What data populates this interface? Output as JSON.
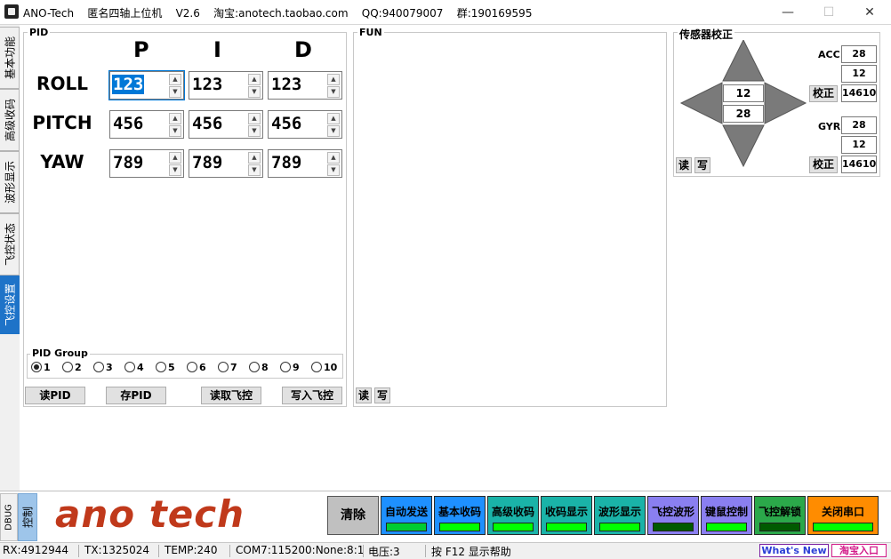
{
  "window": {
    "title": "ANO-Tech    匿名四轴上位机    V2.6    淘宝:anotech.taobao.com    QQ:940079007    群:190169595",
    "minimize": "—",
    "maximize": "☐",
    "close": "✕"
  },
  "left_tabs": [
    "基本功能",
    "高级收码",
    "波形显示",
    "飞控状态",
    "飞控设置"
  ],
  "pid": {
    "group_label": "PID",
    "headers": [
      "P",
      "I",
      "D"
    ],
    "rows": [
      {
        "label": "ROLL",
        "values": [
          "123",
          "123",
          "123"
        ]
      },
      {
        "label": "PITCH",
        "values": [
          "456",
          "456",
          "456"
        ]
      },
      {
        "label": "YAW",
        "values": [
          "789",
          "789",
          "789"
        ]
      }
    ],
    "pid_group": {
      "label": "PID Group",
      "options": [
        "1",
        "2",
        "3",
        "4",
        "5",
        "6",
        "7",
        "8",
        "9",
        "10"
      ],
      "selected": "1"
    },
    "buttons": {
      "read_pid": "读PID",
      "save_pid": "存PID",
      "read_fc": "读取飞控",
      "write_fc": "写入飞控"
    }
  },
  "fun": {
    "label": "FUN",
    "read": "读",
    "write": "写"
  },
  "sensor": {
    "label": "传感器校正",
    "center_values": [
      "12",
      "28"
    ],
    "read": "读",
    "write": "写",
    "acc": {
      "label": "ACC",
      "values": [
        "28",
        "12",
        "14610"
      ],
      "calibrate": "校正"
    },
    "gyr": {
      "label": "GYR",
      "values": [
        "28",
        "12",
        "14610"
      ],
      "calibrate": "校正"
    }
  },
  "bottom": {
    "dbug": "DBUG",
    "control": "控制",
    "logo": "ano tech",
    "clear": "清除",
    "buttons": [
      {
        "label": "自动发送",
        "bg": "#1e90ff",
        "ind": "#00cc33"
      },
      {
        "label": "基本收码",
        "bg": "#1e90ff",
        "ind": "#00ff00"
      },
      {
        "label": "高级收码",
        "bg": "#1ab3a8",
        "ind": "#00ff00"
      },
      {
        "label": "收码显示",
        "bg": "#1ab3a8",
        "ind": "#00ff00"
      },
      {
        "label": "波形显示",
        "bg": "#1ab3a8",
        "ind": "#00ff00"
      },
      {
        "label": "飞控波形",
        "bg": "#8a7ff0",
        "ind": "#005a00"
      },
      {
        "label": "键鼠控制",
        "bg": "#8a7ff0",
        "ind": "#00ff00"
      },
      {
        "label": "飞控解锁",
        "bg": "#2ba84a",
        "ind": "#005a00"
      },
      {
        "label": "关闭串口",
        "bg": "#ff8c00",
        "ind": "#00ff00"
      }
    ]
  },
  "status": {
    "rx": "RX:4912944",
    "tx": "TX:1325024",
    "temp": "TEMP:240",
    "com": "COM7:115200:None:8:1",
    "voltage": "电压:3",
    "help": "按 F12 显示帮助",
    "whats_new": "What's New",
    "taobao": "淘宝入口"
  },
  "colors": {
    "accent": "#1e73c8",
    "logo": "#c0391b",
    "clear_btn": "#c0c0c0"
  }
}
